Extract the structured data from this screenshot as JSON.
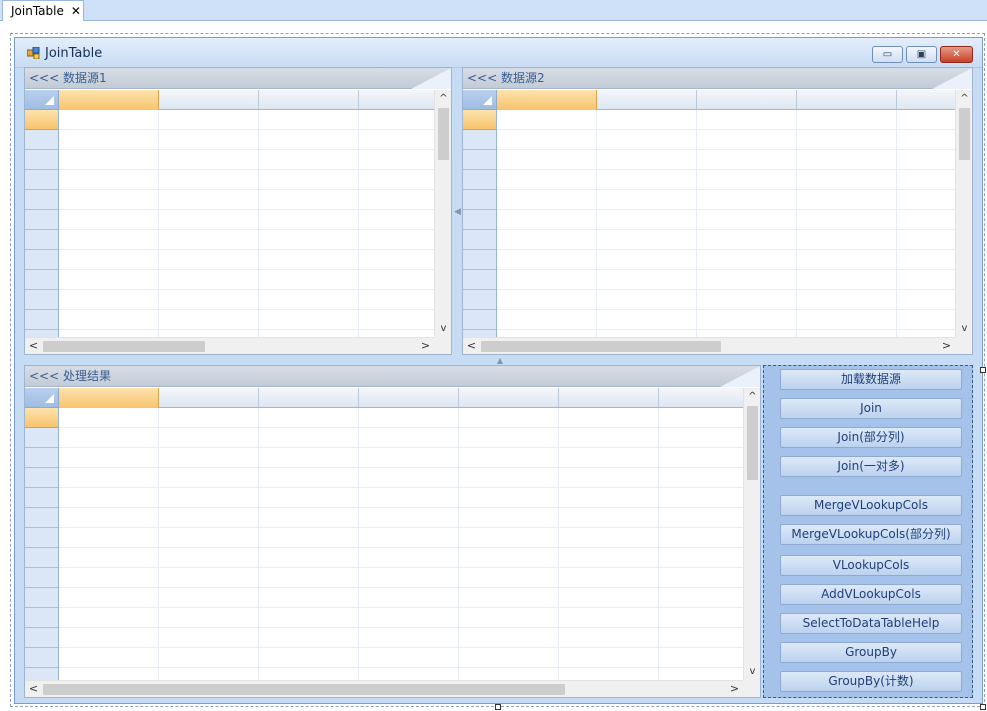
{
  "doc_tab": {
    "label": "JoinTable",
    "close_glyph": "✕"
  },
  "window": {
    "title": "JoinTable",
    "icon": "form-icon",
    "minimize_glyph": "▭",
    "maximize_glyph": "▣",
    "close_glyph": "✕"
  },
  "panels": {
    "source1": {
      "header": "<<< 数据源1"
    },
    "source2": {
      "header": "<<< 数据源2"
    },
    "result": {
      "header": "<<< 处理结果"
    }
  },
  "scroll_glyphs": {
    "up": "^",
    "down": "v",
    "left": "<",
    "right": ">"
  },
  "buttons": [
    {
      "label": "加载数据源"
    },
    {
      "label": "Join"
    },
    {
      "label": "Join(部分列)"
    },
    {
      "label": "Join(一对多)"
    },
    {
      "label": "MergeVLookupCols"
    },
    {
      "label": "MergeVLookupCols(部分列)"
    },
    {
      "label": "VLookupCols"
    },
    {
      "label": "AddVLookupCols"
    },
    {
      "label": "SelectToDataTableHelp"
    },
    {
      "label": "GroupBy"
    },
    {
      "label": "GroupBy(计数)"
    }
  ],
  "colors": {
    "form_bg": "#c6dcf4",
    "button_panel_bg": "#a5c3ea",
    "selected_cell": "#f7c46c",
    "header_text": "#3b5c8f"
  }
}
